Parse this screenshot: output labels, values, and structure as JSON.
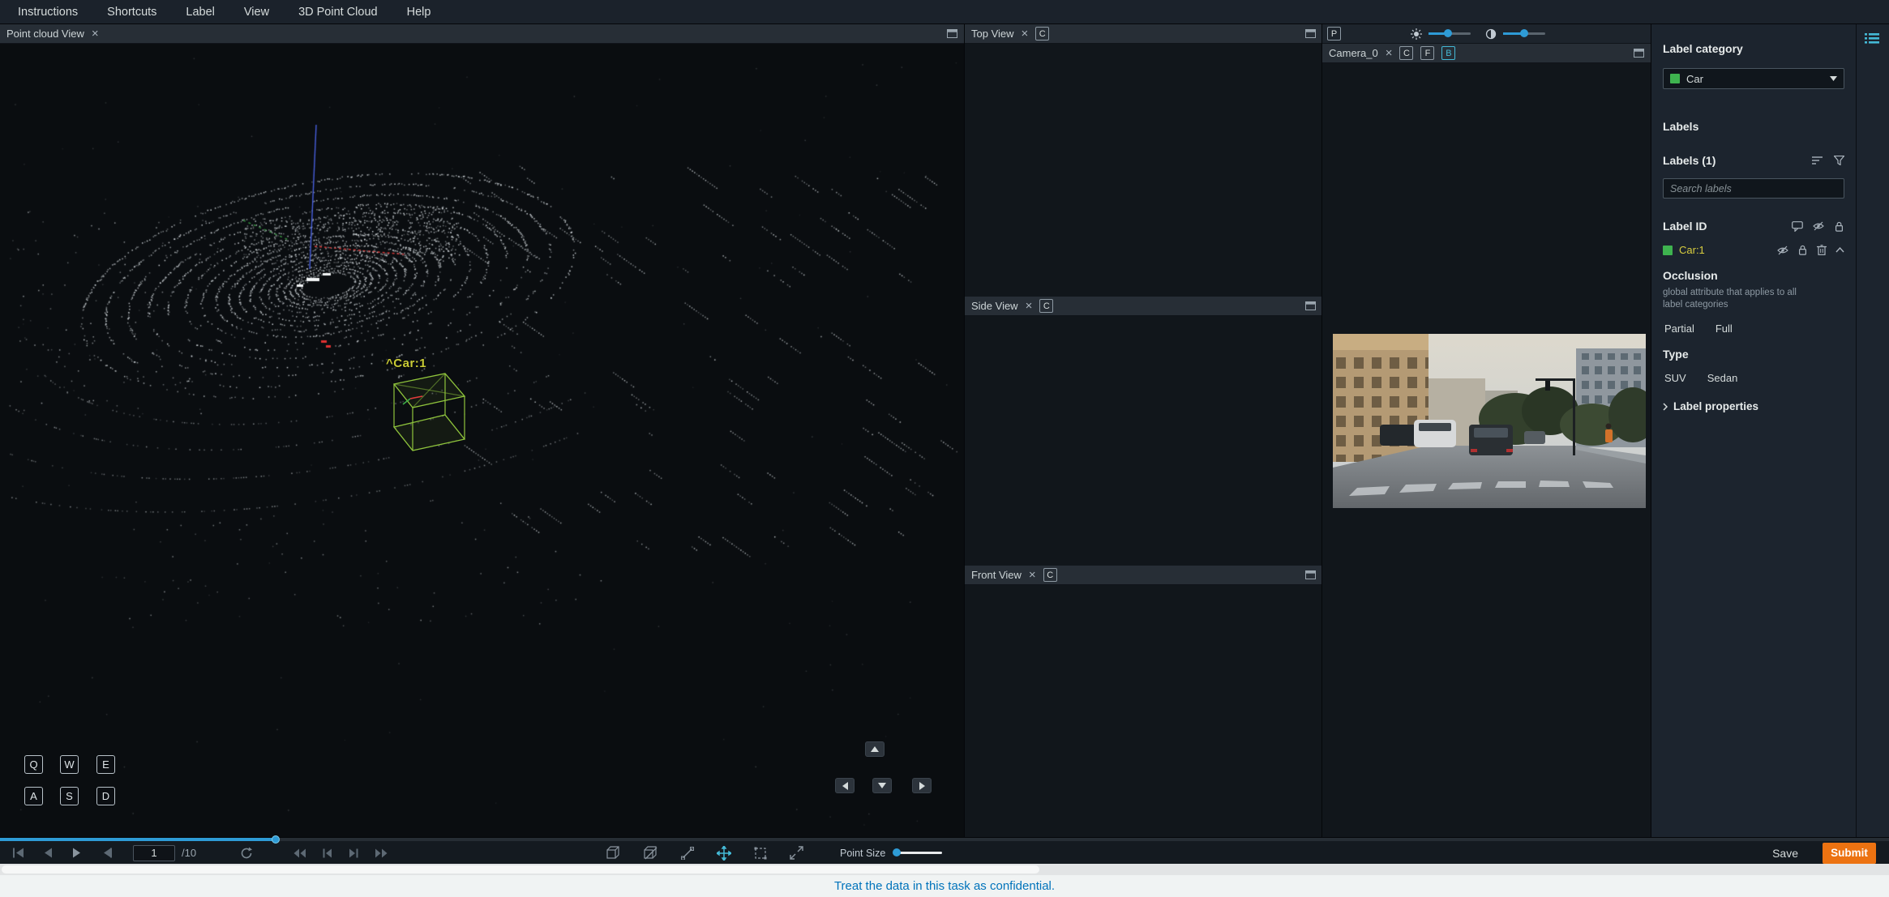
{
  "menubar": {
    "items": [
      "Instructions",
      "Shortcuts",
      "Label",
      "View",
      "3D Point Cloud",
      "Help"
    ]
  },
  "point_cloud_panel": {
    "title": "Point cloud View",
    "close_glyph": "×",
    "annotation": {
      "handle_glyph": "^",
      "label": "Car:1"
    },
    "keys": {
      "row1": [
        "Q",
        "W",
        "E"
      ],
      "row2": [
        "A",
        "S",
        "D"
      ]
    }
  },
  "views": {
    "top": {
      "title": "Top View",
      "close_glyph": "×",
      "camera_toggle": "C"
    },
    "side": {
      "title": "Side View",
      "close_glyph": "×",
      "camera_toggle": "C"
    },
    "front": {
      "title": "Front View",
      "close_glyph": "×",
      "camera_toggle": "C"
    }
  },
  "camera_panel": {
    "projection_toggle": "P",
    "title": "Camera_0",
    "close_glyph": "×",
    "toggles": [
      "C",
      "F",
      "B"
    ],
    "active_toggle": "B"
  },
  "sidebar": {
    "label_category": {
      "title": "Label category",
      "selected": "Car"
    },
    "labels_heading": "Labels",
    "labels_count": "Labels (1)",
    "search": {
      "placeholder": "Search labels"
    },
    "label_id_heading": "Label ID",
    "labels": [
      {
        "name": "Car:1",
        "color": "#3eb34f"
      }
    ],
    "occlusion": {
      "title": "Occlusion",
      "description": "global attribute that applies to all label categories",
      "options": [
        "Partial",
        "Full"
      ]
    },
    "type": {
      "title": "Type",
      "options": [
        "SUV",
        "Sedan"
      ]
    },
    "label_properties_label": "Label properties"
  },
  "toolbar": {
    "frame": {
      "value": "1",
      "total": "/10"
    },
    "point_size_label": "Point Size",
    "save_label": "Save",
    "submit_label": "Submit"
  },
  "banner": {
    "text": "Treat the data in this task as confidential."
  },
  "colors": {
    "accent_blue": "#44b9d6",
    "label_green": "#3eb34f",
    "box_green": "#8fc43c",
    "annotation_yellow": "#c9cb35",
    "submit_orange": "#ec7211",
    "banner_text": "#0073bb"
  }
}
